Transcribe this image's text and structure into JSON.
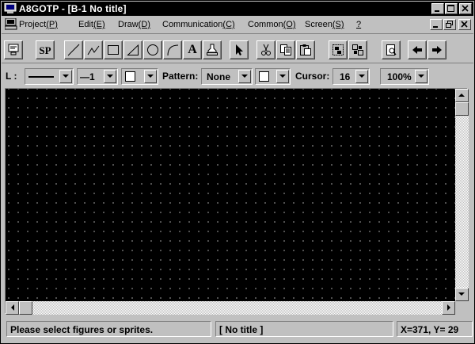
{
  "window": {
    "title": "A8GOTP - [B-1 No title]"
  },
  "menubar": {
    "items": [
      {
        "text": "Project",
        "accel": "(P)"
      },
      {
        "text": "Edit",
        "accel": "(E)"
      },
      {
        "text": "Draw",
        "accel": "(D)"
      },
      {
        "text": "Communication",
        "accel": "(C)"
      },
      {
        "text": "Common",
        "accel": "(O)"
      },
      {
        "text": "Screen",
        "accel": "(S)"
      },
      {
        "text": "",
        "accel": "?"
      }
    ]
  },
  "toolbar": {
    "sp_label": "SP",
    "text_label": "A",
    "icons": [
      "monitor-icon",
      "sp-icon",
      "line-icon",
      "polyline-icon",
      "rectangle-icon",
      "polygon-icon",
      "circle-icon",
      "arc-icon",
      "text-icon",
      "fill-icon",
      "select-arrow-icon",
      "cut-icon",
      "copy-icon",
      "paste-icon",
      "group-icon",
      "ungroup-icon",
      "preview-icon",
      "back-arrow-icon",
      "forward-arrow-icon"
    ]
  },
  "propbar": {
    "line_label": "L :",
    "line_width_value": "—1",
    "pattern_label": "Pattern:",
    "pattern_value": "None",
    "cursor_label": "Cursor:",
    "cursor_value": "16",
    "zoom_value": "100%"
  },
  "statusbar": {
    "message": "Please select figures or sprites.",
    "title": "[ No title ]",
    "coords": "X=371, Y= 29"
  }
}
